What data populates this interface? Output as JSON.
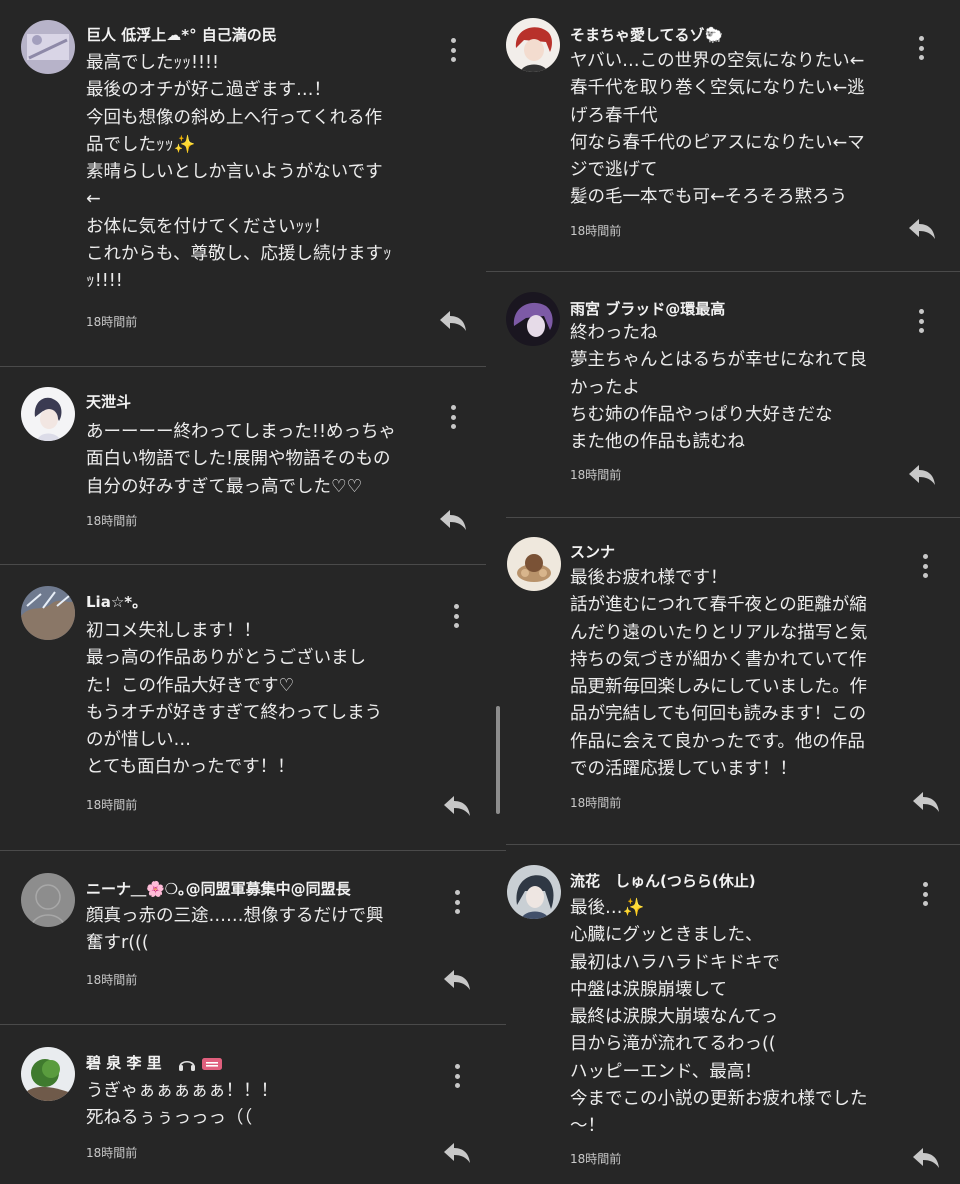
{
  "comments_left": [
    {
      "username": "巨人 低浮上☁*° 自己満の民",
      "body": "最高でしたｯｯ!!!!\n最後のオチが好こ過ぎます…！\n今回も想像の斜め上へ行ってくれる作\n品でしたｯｯ✨\n素晴らしいとしか言いようがないです\n←\nお体に気を付けてくださいｯｯ！\nこれからも、尊敬し、応援し続けますｯ\nｯ!!!!",
      "time": "18時間前"
    },
    {
      "username": "天泄斗",
      "body": "あーーーー終わってしまった!!めっちゃ\n面白い物語でした!展開や物語そのもの\n自分の好みすぎて最っ高でした♡♡",
      "time": "18時間前"
    },
    {
      "username": "Lia☆*。",
      "body": "初コメ失礼します！！\n最っ高の作品ありがとうございまし\nた！この作品大好きです♡\nもうオチが好きすぎて終わってしまう\nのが惜しい…\nとても面白かったです！！",
      "time": "18時間前"
    },
    {
      "username": "ニーナ＿🌸❍｡@同盟軍募集中@同盟長",
      "body": "顔真っ赤の三途……想像するだけで興\n奮すr(((",
      "time": "18時間前"
    },
    {
      "username": "碧 泉 李 里",
      "body": "うぎゃぁぁぁぁぁ！！！\n死ねるぅぅっっっ（（",
      "time": "18時間前"
    }
  ],
  "comments_right": [
    {
      "username": "そまちゃ愛してるゾ🐑",
      "body": "ヤバい…この世界の空気になりたい←\n春千代を取り巻く空気になりたい←逃\nげろ春千代\n何なら春千代のピアスになりたい←マ\nジで逃げて\n髪の毛一本でも可←そろそろ黙ろう",
      "time": "18時間前"
    },
    {
      "username": "雨宮 ブラッド@環最高",
      "body": "終わったね\n夢主ちゃんとはるちが幸せになれて良\nかったよ\nちむ姉の作品やっぱり大好きだな\nまた他の作品も読むね",
      "time": "18時間前"
    },
    {
      "username": "スンナ",
      "body": "最後お疲れ様です！\n話が進むにつれて春千夜との距離が縮\nんだり遠のいたりとリアルな描写と気\n持ちの気づきが細かく書かれていて作\n品更新毎回楽しみにしていました。作\n品が完結しても何回も読みます！この\n作品に会えて良かったです。他の作品\nでの活躍応援しています！！",
      "time": "18時間前"
    },
    {
      "username": "流花　しゅん(つらら(休止)",
      "body": "最後…✨\n心臓にグッときました、\n最初はハラハラドキドキで\n中盤は涙腺崩壊して\n最終は涙腺大崩壊なんてっ\n目から滝が流れてるわっ((\nハッピーエンド、最高！\n今までこの小説の更新お疲れ様でした\n～！",
      "time": "18時間前"
    }
  ],
  "colors": {
    "background": "#262626",
    "text": "#ececec",
    "divider": "#4a4a4a",
    "icon": "#c8c8c8"
  }
}
